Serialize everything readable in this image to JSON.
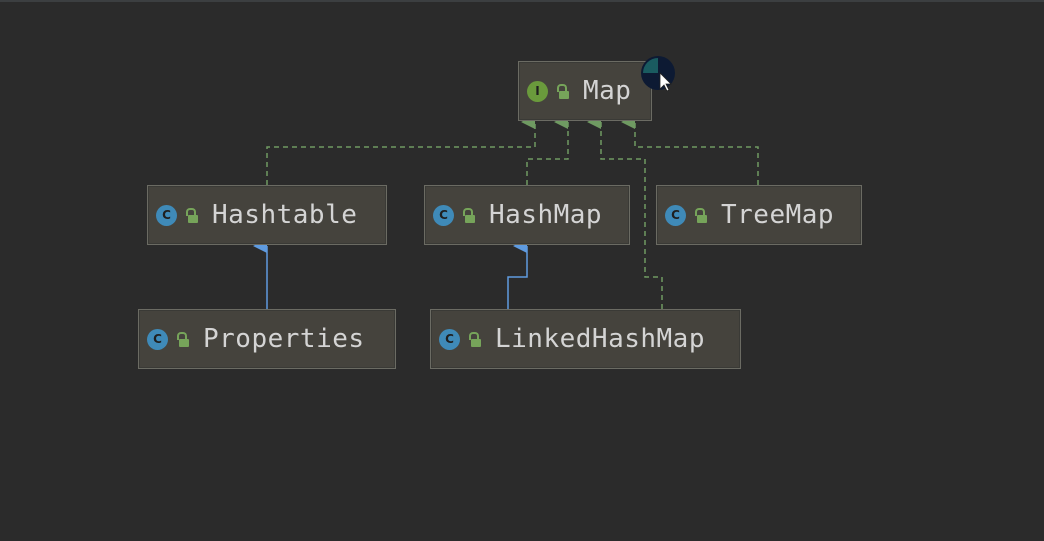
{
  "diagram": {
    "nodes": {
      "map": {
        "label": "Map",
        "kind": "interface",
        "kind_letter": "I"
      },
      "hashtable": {
        "label": "Hashtable",
        "kind": "class",
        "kind_letter": "C"
      },
      "hashmap": {
        "label": "HashMap",
        "kind": "class",
        "kind_letter": "C"
      },
      "treemap": {
        "label": "TreeMap",
        "kind": "class",
        "kind_letter": "C"
      },
      "properties": {
        "label": "Properties",
        "kind": "class",
        "kind_letter": "C"
      },
      "linkedhashmap": {
        "label": "LinkedHashMap",
        "kind": "class",
        "kind_letter": "C"
      }
    },
    "edges": [
      {
        "from": "Hashtable",
        "to": "Map",
        "type": "implements"
      },
      {
        "from": "HashMap",
        "to": "Map",
        "type": "implements"
      },
      {
        "from": "LinkedHashMap",
        "to": "Map",
        "type": "implements"
      },
      {
        "from": "TreeMap",
        "to": "Map",
        "type": "implements"
      },
      {
        "from": "Properties",
        "to": "Hashtable",
        "type": "extends"
      },
      {
        "from": "LinkedHashMap",
        "to": "HashMap",
        "type": "extends"
      }
    ],
    "colors": {
      "background": "#2b2b2b",
      "node_fill": "#45433d",
      "implements_edge": "#6f9a62",
      "extends_edge": "#5f9be0",
      "class_icon": "#3f8ab8",
      "interface_icon": "#6a9a3c",
      "access_icon": "#76a45a"
    }
  }
}
